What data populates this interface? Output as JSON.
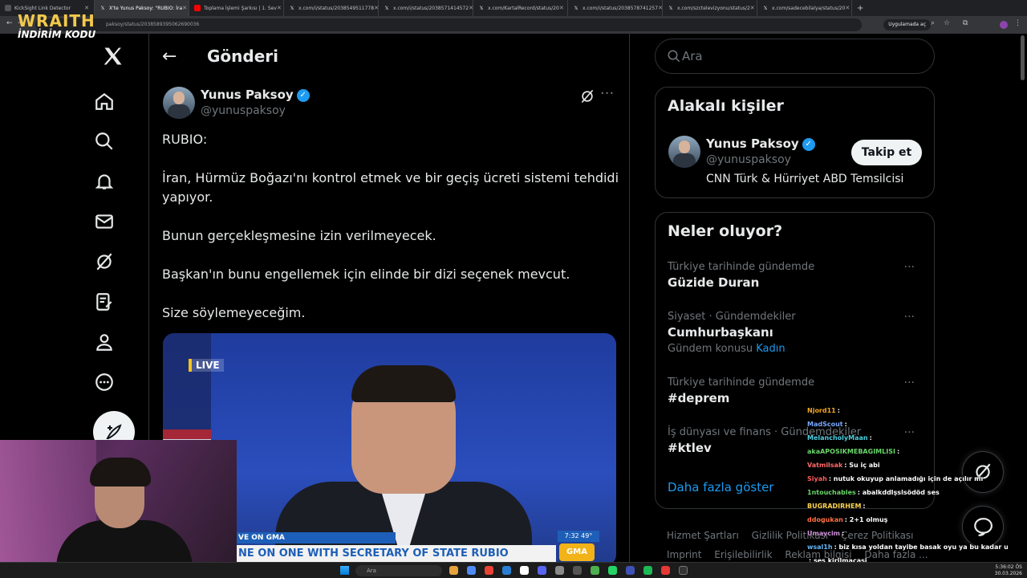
{
  "browser": {
    "tabs": [
      {
        "label": "KickSight Link Detector",
        "active": false
      },
      {
        "label": "X'te Yunus Paksoy: \"RUBIO: İra",
        "active": true
      },
      {
        "label": "Toplama İşlemi Şarkısı | 1. Sev",
        "active": false
      },
      {
        "label": "x.com/i/status/2038549511778",
        "active": false
      },
      {
        "label": "x.com/i/status/2038571414572",
        "active": false
      },
      {
        "label": "x.com/KartalRecord/status/20",
        "active": false
      },
      {
        "label": "x.com/i/status/2038578741257",
        "active": false
      },
      {
        "label": "x.com/szctelevizyonu/status/2",
        "active": false
      },
      {
        "label": "x.com/sadecebilalya/status/20",
        "active": false
      }
    ],
    "url": "paksoy/status/2038589395062690036",
    "app_button": "Uygulamada aç"
  },
  "overlay_brand": {
    "title": "WRAITH",
    "subtitle": "İNDİRİM KODU"
  },
  "header": {
    "title": "Gönderi"
  },
  "tweet": {
    "author_name": "Yunus Paksoy",
    "author_handle": "@yunuspaksoy",
    "lines": [
      "RUBIO:",
      "İran, Hürmüz Boğazı'nı kontrol etmek ve bir geçiş ücreti sistemi tehdidi",
      "yapıyor.",
      "Bunun gerçekleşmesine izin verilmeyecek.",
      "Başkan'ın bunu engellemek için elinde bir dizi seçenek mevcut.",
      "Size söylemeyeceğim."
    ],
    "media": {
      "live_badge": "LIVE",
      "lower_third_top": "VE ON GMA",
      "lower_third_main": "NE ON ONE WITH SECRETARY OF STATE RUBIO",
      "clock": "7:32  49°",
      "channel": "GMA"
    }
  },
  "search": {
    "placeholder": "Ara"
  },
  "related": {
    "title": "Alakalı kişiler",
    "name": "Yunus Paksoy",
    "handle": "@yunuspaksoy",
    "bio": "CNN Türk & Hürriyet ABD Temsilcisi",
    "follow_label": "Takip et"
  },
  "trends": {
    "title": "Neler oluyor?",
    "items": [
      {
        "context": "Türkiye tarihinde gündemde",
        "name": "Güzide Duran",
        "extra": "",
        "extra_hl": ""
      },
      {
        "context": "Siyaset · Gündemdekiler",
        "name": "Cumhurbaşkanı",
        "extra": "Gündem konusu",
        "extra_hl": "Kadın"
      },
      {
        "context": "Türkiye tarihinde gündemde",
        "name": "#deprem",
        "extra": "",
        "extra_hl": ""
      },
      {
        "context": "İş dünyası ve finans · Gündemdekiler",
        "name": "#ktlev",
        "extra": "",
        "extra_hl": ""
      }
    ],
    "show_more": "Daha fazla göster"
  },
  "footer": {
    "links": [
      "Hizmet Şartları",
      "Gizlilik Politikası",
      "Çerez Politikası",
      "Imprint",
      "Erişilebilirlik",
      "Reklam bilgisi",
      "Daha fazla ..."
    ]
  },
  "chat": {
    "messages": [
      {
        "user": "Njord11",
        "text": ":",
        "color": "#f5a623"
      },
      {
        "user": "MadScout",
        "text": ":",
        "color": "#7aa7ff"
      },
      {
        "user": "MelancholyMaan",
        "text": ":",
        "color": "#4dd0e1"
      },
      {
        "user": "akaAPOSIKMEBAGIMLISI",
        "text": ":",
        "color": "#6bd66b"
      },
      {
        "user": "Vatmilsak",
        "text": ": Su iç abi",
        "color": "#ff6b6b"
      },
      {
        "user": "Siyah",
        "text": ": nutuk okuyup anlamadığı için de açılır mı",
        "color": "#ff5c5c"
      },
      {
        "user": "1ntouchables",
        "text": ": abalkddlşslsödöd ses",
        "color": "#6bd66b"
      },
      {
        "user": "BUGRADIRHEM",
        "text": ":",
        "color": "#ffd54f"
      },
      {
        "user": "ddogukan",
        "text": ": 2+1 olmuş",
        "color": "#ff7043"
      },
      {
        "user": "Umaycim",
        "text": ":",
        "color": "#ce93d8"
      },
      {
        "user": "wsal1h",
        "text": ": biz kısa yoldan tayibe basak oyu ya bu kadar uğraşmasın adam",
        "color": "#64b5f6"
      },
      {
        "user": "",
        "text": ": ses kirilmacasi",
        "color": "#ffffff"
      }
    ]
  },
  "taskbar": {
    "search_label": "Ara",
    "time": "5:36:02 ÖS",
    "date": "30.03.2026"
  },
  "colors": {
    "accent": "#1d9bf0",
    "bg": "#000000",
    "text": "#e7e9ea",
    "muted": "#71767b",
    "border": "#2f3336",
    "brand_yellow": "#f2c94c"
  }
}
